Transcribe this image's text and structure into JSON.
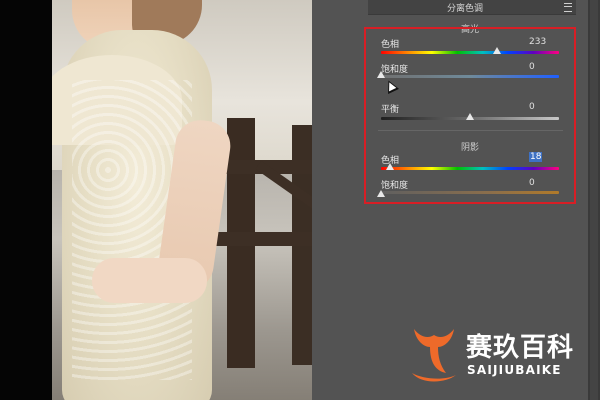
{
  "panel": {
    "title": "分离色调",
    "highlights_label": "高光",
    "shadows_label": "阴影",
    "menu_icon": "panel-menu-icon"
  },
  "highlights": {
    "hue": {
      "label": "色相",
      "value": "233",
      "fraction": 0.65
    },
    "saturation": {
      "label": "饱和度",
      "value": "0",
      "fraction": 0.0
    }
  },
  "balance": {
    "label": "平衡",
    "value": "0",
    "fraction": 0.5
  },
  "shadows": {
    "hue": {
      "label": "色相",
      "value": "18",
      "fraction": 0.05
    },
    "saturation": {
      "label": "饱和度",
      "value": "0",
      "fraction": 0.0
    }
  },
  "logo": {
    "name_cn": "赛玖百科",
    "name_en": "SAIJIUBAIKE",
    "brand_color": "#ee6a2a"
  },
  "colors": {
    "highlight_box": "#d81e25",
    "panel_bg": "#535353",
    "selection": "#3e71c4"
  }
}
